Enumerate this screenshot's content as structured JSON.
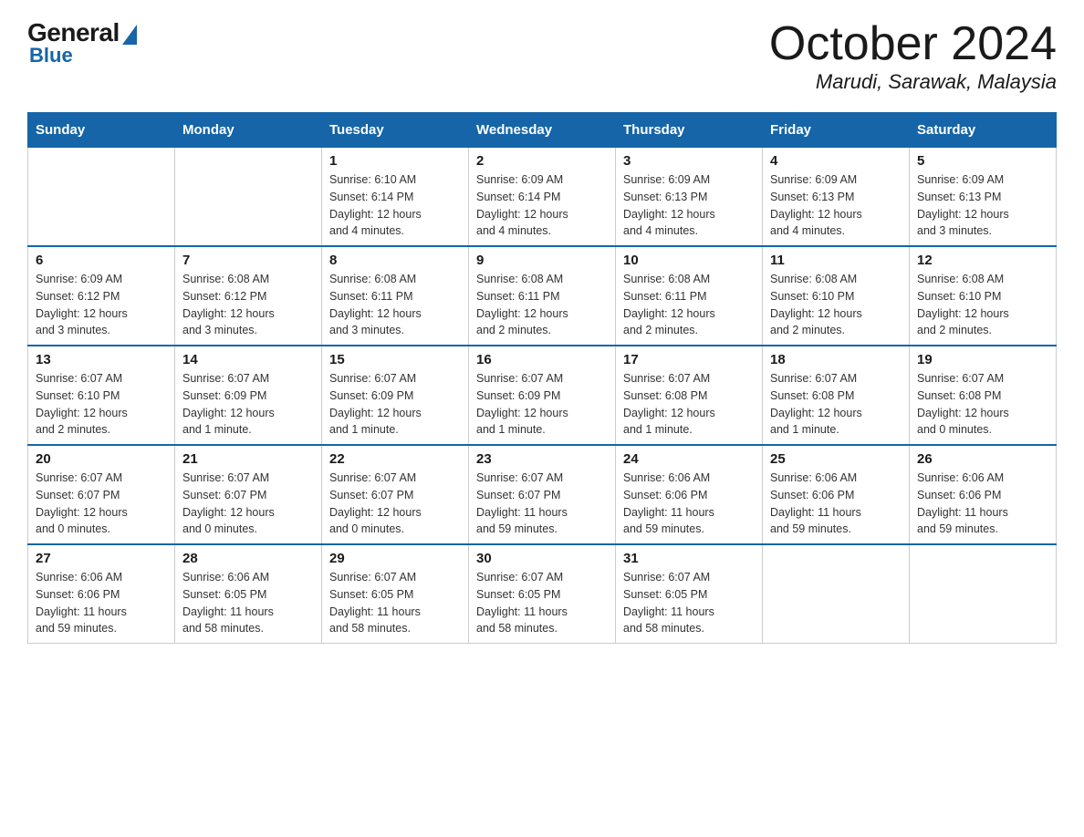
{
  "logo": {
    "general": "General",
    "blue": "Blue"
  },
  "title": {
    "month_year": "October 2024",
    "location": "Marudi, Sarawak, Malaysia"
  },
  "weekdays": [
    "Sunday",
    "Monday",
    "Tuesday",
    "Wednesday",
    "Thursday",
    "Friday",
    "Saturday"
  ],
  "weeks": [
    [
      {
        "day": "",
        "info": ""
      },
      {
        "day": "",
        "info": ""
      },
      {
        "day": "1",
        "info": "Sunrise: 6:10 AM\nSunset: 6:14 PM\nDaylight: 12 hours\nand 4 minutes."
      },
      {
        "day": "2",
        "info": "Sunrise: 6:09 AM\nSunset: 6:14 PM\nDaylight: 12 hours\nand 4 minutes."
      },
      {
        "day": "3",
        "info": "Sunrise: 6:09 AM\nSunset: 6:13 PM\nDaylight: 12 hours\nand 4 minutes."
      },
      {
        "day": "4",
        "info": "Sunrise: 6:09 AM\nSunset: 6:13 PM\nDaylight: 12 hours\nand 4 minutes."
      },
      {
        "day": "5",
        "info": "Sunrise: 6:09 AM\nSunset: 6:13 PM\nDaylight: 12 hours\nand 3 minutes."
      }
    ],
    [
      {
        "day": "6",
        "info": "Sunrise: 6:09 AM\nSunset: 6:12 PM\nDaylight: 12 hours\nand 3 minutes."
      },
      {
        "day": "7",
        "info": "Sunrise: 6:08 AM\nSunset: 6:12 PM\nDaylight: 12 hours\nand 3 minutes."
      },
      {
        "day": "8",
        "info": "Sunrise: 6:08 AM\nSunset: 6:11 PM\nDaylight: 12 hours\nand 3 minutes."
      },
      {
        "day": "9",
        "info": "Sunrise: 6:08 AM\nSunset: 6:11 PM\nDaylight: 12 hours\nand 2 minutes."
      },
      {
        "day": "10",
        "info": "Sunrise: 6:08 AM\nSunset: 6:11 PM\nDaylight: 12 hours\nand 2 minutes."
      },
      {
        "day": "11",
        "info": "Sunrise: 6:08 AM\nSunset: 6:10 PM\nDaylight: 12 hours\nand 2 minutes."
      },
      {
        "day": "12",
        "info": "Sunrise: 6:08 AM\nSunset: 6:10 PM\nDaylight: 12 hours\nand 2 minutes."
      }
    ],
    [
      {
        "day": "13",
        "info": "Sunrise: 6:07 AM\nSunset: 6:10 PM\nDaylight: 12 hours\nand 2 minutes."
      },
      {
        "day": "14",
        "info": "Sunrise: 6:07 AM\nSunset: 6:09 PM\nDaylight: 12 hours\nand 1 minute."
      },
      {
        "day": "15",
        "info": "Sunrise: 6:07 AM\nSunset: 6:09 PM\nDaylight: 12 hours\nand 1 minute."
      },
      {
        "day": "16",
        "info": "Sunrise: 6:07 AM\nSunset: 6:09 PM\nDaylight: 12 hours\nand 1 minute."
      },
      {
        "day": "17",
        "info": "Sunrise: 6:07 AM\nSunset: 6:08 PM\nDaylight: 12 hours\nand 1 minute."
      },
      {
        "day": "18",
        "info": "Sunrise: 6:07 AM\nSunset: 6:08 PM\nDaylight: 12 hours\nand 1 minute."
      },
      {
        "day": "19",
        "info": "Sunrise: 6:07 AM\nSunset: 6:08 PM\nDaylight: 12 hours\nand 0 minutes."
      }
    ],
    [
      {
        "day": "20",
        "info": "Sunrise: 6:07 AM\nSunset: 6:07 PM\nDaylight: 12 hours\nand 0 minutes."
      },
      {
        "day": "21",
        "info": "Sunrise: 6:07 AM\nSunset: 6:07 PM\nDaylight: 12 hours\nand 0 minutes."
      },
      {
        "day": "22",
        "info": "Sunrise: 6:07 AM\nSunset: 6:07 PM\nDaylight: 12 hours\nand 0 minutes."
      },
      {
        "day": "23",
        "info": "Sunrise: 6:07 AM\nSunset: 6:07 PM\nDaylight: 11 hours\nand 59 minutes."
      },
      {
        "day": "24",
        "info": "Sunrise: 6:06 AM\nSunset: 6:06 PM\nDaylight: 11 hours\nand 59 minutes."
      },
      {
        "day": "25",
        "info": "Sunrise: 6:06 AM\nSunset: 6:06 PM\nDaylight: 11 hours\nand 59 minutes."
      },
      {
        "day": "26",
        "info": "Sunrise: 6:06 AM\nSunset: 6:06 PM\nDaylight: 11 hours\nand 59 minutes."
      }
    ],
    [
      {
        "day": "27",
        "info": "Sunrise: 6:06 AM\nSunset: 6:06 PM\nDaylight: 11 hours\nand 59 minutes."
      },
      {
        "day": "28",
        "info": "Sunrise: 6:06 AM\nSunset: 6:05 PM\nDaylight: 11 hours\nand 58 minutes."
      },
      {
        "day": "29",
        "info": "Sunrise: 6:07 AM\nSunset: 6:05 PM\nDaylight: 11 hours\nand 58 minutes."
      },
      {
        "day": "30",
        "info": "Sunrise: 6:07 AM\nSunset: 6:05 PM\nDaylight: 11 hours\nand 58 minutes."
      },
      {
        "day": "31",
        "info": "Sunrise: 6:07 AM\nSunset: 6:05 PM\nDaylight: 11 hours\nand 58 minutes."
      },
      {
        "day": "",
        "info": ""
      },
      {
        "day": "",
        "info": ""
      }
    ]
  ]
}
